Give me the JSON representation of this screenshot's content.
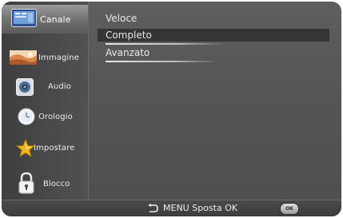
{
  "sidebar": {
    "items": [
      {
        "label": "Canale",
        "icon": "tv-icon",
        "active": true
      },
      {
        "label": "Immagine",
        "icon": "picture-icon",
        "active": false
      },
      {
        "label": "Audio",
        "icon": "speaker-icon",
        "active": false
      },
      {
        "label": "Orologio",
        "icon": "clock-icon",
        "active": false
      },
      {
        "label": "Impostare",
        "icon": "star-icon",
        "active": false
      },
      {
        "label": "Blocco",
        "icon": "lock-icon",
        "active": false
      }
    ]
  },
  "main": {
    "options": [
      {
        "label": "Veloce",
        "selected": false
      },
      {
        "label": "Completo",
        "selected": true
      },
      {
        "label": "Avanzato",
        "selected": false
      }
    ]
  },
  "footer": {
    "hint": "MENU Sposta OK",
    "ok_label": "OK",
    "back_icon": "return-arrow-icon"
  },
  "colors": {
    "panel": "#575757",
    "sidebar": "#444444",
    "active_item": "#8a8a8a",
    "selection_bar": "#353535",
    "text": "#e8e8e8"
  }
}
